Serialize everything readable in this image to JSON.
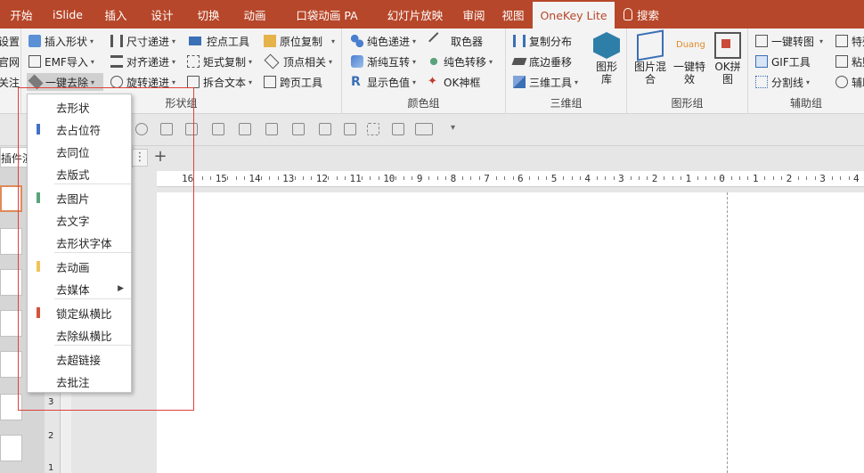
{
  "tabs": [
    {
      "label": "开始"
    },
    {
      "label": "iSlide"
    },
    {
      "label": "插入"
    },
    {
      "label": "设计"
    },
    {
      "label": "切换"
    },
    {
      "label": "动画"
    },
    {
      "label": "口袋动画 PA"
    },
    {
      "label": "幻灯片放映"
    },
    {
      "label": "审阅"
    },
    {
      "label": "视图"
    },
    {
      "label": "OneKey Lite"
    },
    {
      "label": "搜索"
    }
  ],
  "ribbon": {
    "left_partial": [
      "设置",
      "官网",
      "关注"
    ],
    "shape_group": {
      "label": "形状组",
      "col1": [
        "插入形状",
        "EMF导入",
        "一键去除"
      ],
      "col2": [
        "尺寸递进",
        "对齐递进",
        "旋转递进"
      ],
      "col3": [
        "控点工具",
        "矩式复制",
        "拆合文本"
      ],
      "col4": [
        "原位复制",
        "顶点相关",
        "跨页工具"
      ]
    },
    "color_group": {
      "label": "颜色组",
      "col1": [
        "纯色递进",
        "渐纯互转",
        "显示色值"
      ],
      "col2": [
        "取色器",
        "纯色转移",
        "OK神框"
      ]
    },
    "threed_group": {
      "label": "三维组",
      "col1": [
        "复制分布",
        "底边垂移",
        "三维工具"
      ],
      "big": "图形库"
    },
    "graphic_group": {
      "label": "图形组",
      "big1": "图片混合",
      "big2": "一键特效",
      "big2_badge": "Duang",
      "big3": "OK拼图"
    },
    "aux_group": {
      "label": "辅助组",
      "col1": [
        "一键转图",
        "GIF工具",
        "分割线"
      ],
      "col2": [
        "特殊",
        "粘贴",
        "辅助"
      ]
    }
  },
  "panel": {
    "tab_label": "插件演",
    "more": "⋮",
    "plus": "+"
  },
  "ruler": {
    "h_labels": [
      "16",
      "15",
      "14",
      "13",
      "12",
      "11",
      "10",
      "9",
      "8",
      "7",
      "6",
      "5",
      "4",
      "3",
      "2",
      "1",
      "0",
      "1",
      "2",
      "3",
      "4"
    ],
    "v_labels": [
      "3",
      "2",
      "1"
    ]
  },
  "menu": {
    "items": [
      {
        "label": "去形状",
        "color": ""
      },
      {
        "label": "去占位符",
        "color": "#4472c4"
      },
      {
        "label": "去同位",
        "color": ""
      },
      {
        "label": "去版式",
        "color": ""
      },
      {
        "label": "去图片",
        "color": "#5aa47c"
      },
      {
        "label": "去文字",
        "color": ""
      },
      {
        "label": "去形状字体",
        "color": ""
      },
      {
        "label": "去动画",
        "color": "#f0c35a"
      },
      {
        "label": "去媒体",
        "color": ""
      },
      {
        "label": "锁定纵横比",
        "color": "#d2553b"
      },
      {
        "label": "去除纵横比",
        "color": ""
      },
      {
        "label": "去超链接",
        "color": ""
      },
      {
        "label": "去批注",
        "color": ""
      }
    ],
    "submenu_arrow": "▶"
  },
  "colors": {
    "accent": "#b7472a",
    "highlight": "#e0403a"
  }
}
